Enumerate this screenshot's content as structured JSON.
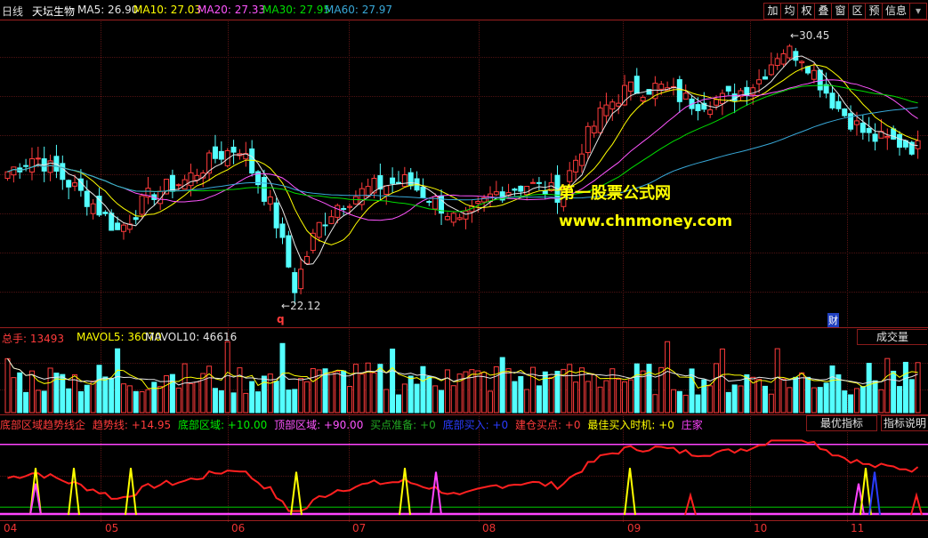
{
  "colors": {
    "up": "#ff3b3b",
    "down": "#54ffff",
    "ma5": "#e6e6e6",
    "ma10": "#ffff00",
    "ma20": "#ff55ff",
    "ma30": "#00dd00",
    "ma60": "#38a8d8"
  },
  "header": {
    "period": "日线",
    "stock": "天坛生物",
    "ma5": "MA5: 26.90",
    "ma10": "MA10: 27.03",
    "ma20": "MA20: 27.33",
    "ma30": "MA30: 27.95",
    "ma60": "MA60: 27.97",
    "buttons": [
      "加",
      "均",
      "权",
      "叠",
      "窗",
      "区",
      "预",
      "信息"
    ]
  },
  "price": {
    "high_label": "30.45",
    "low_label": "22.12",
    "marker_q": "q",
    "marker_cai": "财"
  },
  "volume": {
    "total": "总手: 13493",
    "mavol5": "MAVOL5: 36070",
    "mavol10": "MAVOL10: 46616",
    "button": "成交量"
  },
  "indicator": {
    "name": "底部区域趋势线企",
    "trend": "趋势线: +14.95",
    "bottom": "底部区域: +10.00",
    "top": "顶部区域: +90.00",
    "buy_prep": "买点准备: +0",
    "bottom_buy": "底部买入: +0",
    "build_buy": "建仓买点: +0",
    "best_time": "最佳买入时机: +0",
    "zhuang": "庄家",
    "btn_optimal": "最优指标",
    "btn_help": "指标说明"
  },
  "xaxis": [
    "04",
    "05",
    "06",
    "07",
    "08",
    "09",
    "10",
    "11"
  ],
  "watermark": {
    "line1": "第一股票公式网",
    "line2": "www.chnmoney.com"
  },
  "chart_data": {
    "type": "candlestick",
    "price_range": [
      22.12,
      30.45
    ],
    "ma_last": {
      "MA5": 26.9,
      "MA10": 27.03,
      "MA20": 27.33,
      "MA30": 27.95,
      "MA60": 27.97
    },
    "volume_last": 13493,
    "mavol5": 36070,
    "mavol10": 46616,
    "indicator_values": {
      "趋势线": 14.95,
      "底部区域": 10.0,
      "顶部区域": 90.0
    }
  }
}
